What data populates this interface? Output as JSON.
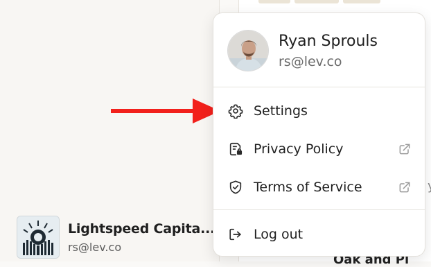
{
  "menu": {
    "user_name": "Ryan Sprouls",
    "user_email": "rs@lev.co",
    "items": [
      {
        "label": "Settings",
        "icon": "gear-icon"
      },
      {
        "label": "Privacy Policy",
        "icon": "document-lock-icon",
        "external": true
      },
      {
        "label": "Terms of Service",
        "icon": "shield-check-icon",
        "external": true
      },
      {
        "label": "Log out",
        "icon": "logout-icon"
      }
    ]
  },
  "sidebar": {
    "org_name": "Lightspeed Capita...",
    "org_email": "rs@lev.co"
  },
  "background": {
    "peek_fragment_1": "y",
    "peek_fragment_2": "Oak and Pl"
  },
  "colors": {
    "annotation_arrow": "#f2201b",
    "sidebar_bg": "#f8f6f3",
    "menu_bg": "#ffffff"
  }
}
